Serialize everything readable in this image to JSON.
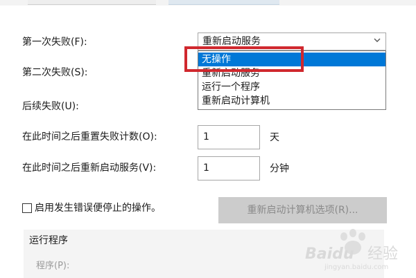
{
  "rows": {
    "first_failure_label": "第一次失败(F):",
    "second_failure_label": "第二次失败(S):",
    "subsequent_failure_label": "后续失败(U):",
    "reset_count_label": "在此时间之后重置失败计数(O):",
    "reset_count_value": "1",
    "reset_count_unit": "天",
    "restart_service_label": "在此时间之后重新启动服务(V):",
    "restart_service_value": "1",
    "restart_service_unit": "分钟"
  },
  "first_failure_select": {
    "value": "重新启动服务",
    "icon": "chevron-down-icon",
    "options": [
      "无操作",
      "重新启动服务",
      "运行一个程序",
      "重新启动计算机"
    ],
    "highlighted_index": 0
  },
  "stop_on_error": {
    "label": "启用发生错误便停止的操作。",
    "checked": false
  },
  "restart_computer_options_button": "重新启动计算机选项(R)...",
  "run_program": {
    "title": "运行程序",
    "program_label": "程序(P):"
  },
  "watermark": {
    "brand": "Baidu",
    "cn": "经验",
    "url": "jingyan.baidu.com"
  },
  "colors": {
    "selection": "#0078d7",
    "highlight_box": "#d0282e",
    "disabled_button": "#cccccc"
  }
}
